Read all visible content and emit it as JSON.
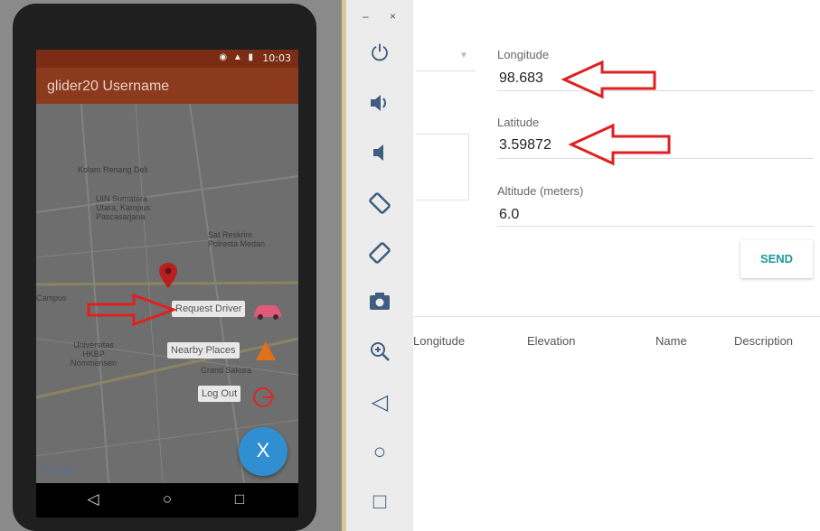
{
  "phone": {
    "status_time": "10:03",
    "app_title": "glider20 Username",
    "map_labels": [
      "Kolam Renang Deli",
      "UIN Sumatera\nUtara, Kampus\nPascasarjana",
      "Sat Reskrim\nPolresta Medan",
      "Campus",
      "Universitas\nHKBP\nNommensen",
      "Grand Sakura",
      "Google"
    ],
    "menu": {
      "request_driver": "Request Driver",
      "nearby_places": "Nearby Places",
      "log_out": "Log Out"
    },
    "fab_label": "X"
  },
  "window_controls": "– ×",
  "location": {
    "longitude_label": "Longitude",
    "longitude_value": "98.683",
    "latitude_label": "Latitude",
    "latitude_value": "3.59872",
    "altitude_label": "Altitude (meters)",
    "altitude_value": "6.0",
    "send_label": "SEND"
  },
  "table": {
    "columns": [
      "Longitude",
      "Elevation",
      "Name",
      "Description"
    ]
  },
  "toolbar_icons": [
    "power-icon",
    "volume-up-icon",
    "volume-down-icon",
    "rotate-left-icon",
    "rotate-right-icon",
    "camera-icon",
    "zoom-in-icon",
    "back-icon",
    "home-icon",
    "overview-icon"
  ],
  "colors": {
    "annotation_arrow": "#e02020",
    "fab": "#2f8fd0",
    "send_text": "#1a9a9a",
    "appbar": "#8b3a1e"
  }
}
